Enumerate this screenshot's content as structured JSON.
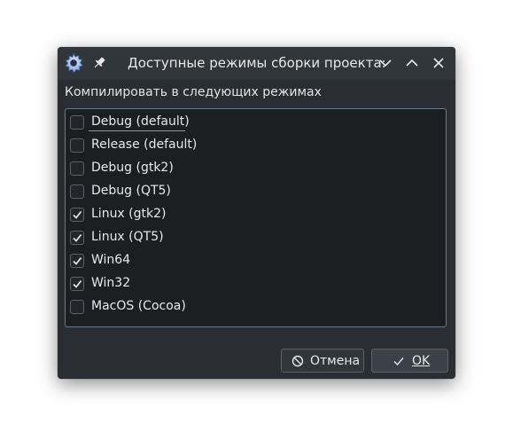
{
  "window": {
    "title": "Доступные режимы сборки проекта:",
    "controls": [
      "chevron-down-icon",
      "chevron-up-icon",
      "close-icon"
    ]
  },
  "group": {
    "label": "Компилировать в следующих режимах"
  },
  "modes": [
    {
      "label": "Debug (default)",
      "checked": false,
      "focused": true
    },
    {
      "label": "Release (default)",
      "checked": false
    },
    {
      "label": "Debug (gtk2)",
      "checked": false
    },
    {
      "label": "Debug (QT5)",
      "checked": false
    },
    {
      "label": "Linux (gtk2)",
      "checked": true
    },
    {
      "label": "Linux (QT5)",
      "checked": true
    },
    {
      "label": "Win64",
      "checked": true
    },
    {
      "label": "Win32",
      "checked": true
    },
    {
      "label": "MacOS (Cocoa)",
      "checked": false
    }
  ],
  "buttons": {
    "cancel_label": "Отмена",
    "ok_label": "OK"
  },
  "colors": {
    "window_bg": "#2a2e32",
    "titlebar_bg": "#31363b",
    "list_bg": "#1c1f22",
    "accent": "#3daee9",
    "text": "#e8e8e8"
  }
}
